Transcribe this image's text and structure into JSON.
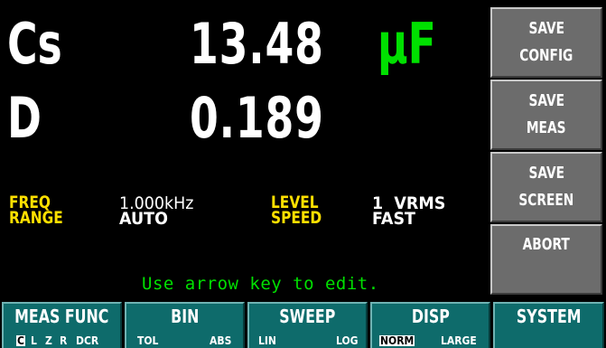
{
  "measurement": {
    "primary_name": "Cs",
    "primary_value": "13.48",
    "primary_unit": "µF",
    "secondary_name": "D",
    "secondary_value": "0.189"
  },
  "params": {
    "freq_label": "FREQ",
    "freq_value": "1.000kHz",
    "level_label": "LEVEL",
    "level_value": "1  VRMS",
    "range_label": "RANGE",
    "range_value": "AUTO",
    "speed_label": "SPEED",
    "speed_value": "FAST"
  },
  "hint": "Use arrow key to edit.",
  "side_keys": {
    "save_config": [
      "SAVE",
      "CONFIG"
    ],
    "save_meas": [
      "SAVE",
      "MEAS"
    ],
    "save_screen": [
      "SAVE",
      "SCREEN"
    ],
    "abort": "ABORT"
  },
  "bottom_keys": {
    "meas_func": {
      "title": "MEAS FUNC",
      "options": [
        "C",
        "L",
        "Z",
        "R",
        "DCR"
      ],
      "selected": "C"
    },
    "bin": {
      "title": "BIN",
      "options": [
        "TOL",
        "ABS"
      ]
    },
    "sweep": {
      "title": "SWEEP",
      "options": [
        "LIN",
        "LOG"
      ]
    },
    "disp": {
      "title": "DISP",
      "options": [
        "NORM",
        "LARGE"
      ],
      "selected": "NORM"
    },
    "system": {
      "title": "SYSTEM"
    }
  },
  "colors": {
    "background": "#000000",
    "label_yellow": "#ffe000",
    "unit_green": "#00e000",
    "softkey_gray": "#6c6c6c",
    "bottomkey_teal": "#0e6b6b"
  }
}
